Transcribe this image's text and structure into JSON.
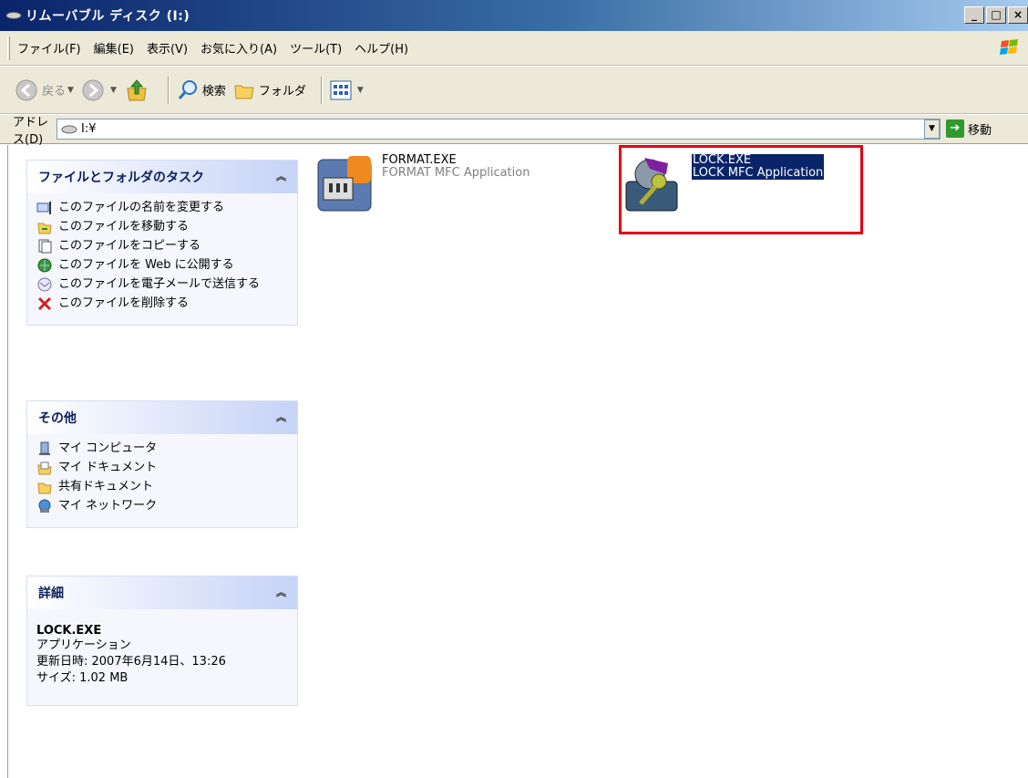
{
  "window": {
    "title": "リムーバブル ディスク (I:)",
    "buttons": {
      "minimize": "_",
      "maximize": "□",
      "close": "×"
    }
  },
  "menubar": {
    "items": [
      "ファイル(F)",
      "編集(E)",
      "表示(V)",
      "お気に入り(A)",
      "ツール(T)",
      "ヘルプ(H)"
    ]
  },
  "toolbar": {
    "back_label": "戻る",
    "search_label": "検索",
    "folders_label": "フォルダ"
  },
  "address": {
    "label": "アドレス(D)",
    "value": "I:¥",
    "go_label": "移動"
  },
  "panels": {
    "tasks": {
      "title": "ファイルとフォルダのタスク",
      "items": [
        "このファイルの名前を変更する",
        "このファイルを移動する",
        "このファイルをコピーする",
        "このファイルを Web に公開する",
        "このファイルを電子メールで送信する",
        "このファイルを削除する"
      ]
    },
    "other": {
      "title": "その他",
      "items": [
        "マイ コンピュータ",
        "マイ ドキュメント",
        "共有ドキュメント",
        "マイ ネットワーク"
      ]
    },
    "details": {
      "title": "詳細",
      "name": "LOCK.EXE",
      "type": "アプリケーション",
      "modified": "更新日時: 2007年6月14日、13:26",
      "size": "サイズ: 1.02 MB"
    }
  },
  "files": [
    {
      "name": "FORMAT.EXE",
      "desc": "FORMAT MFC Application",
      "selected": false
    },
    {
      "name": "LOCK.EXE",
      "desc": "LOCK MFC Application",
      "selected": true
    }
  ],
  "colors": {
    "selection": "#0a246a",
    "highlight_box": "#e60012",
    "panel_title": "#0c1e5b"
  }
}
